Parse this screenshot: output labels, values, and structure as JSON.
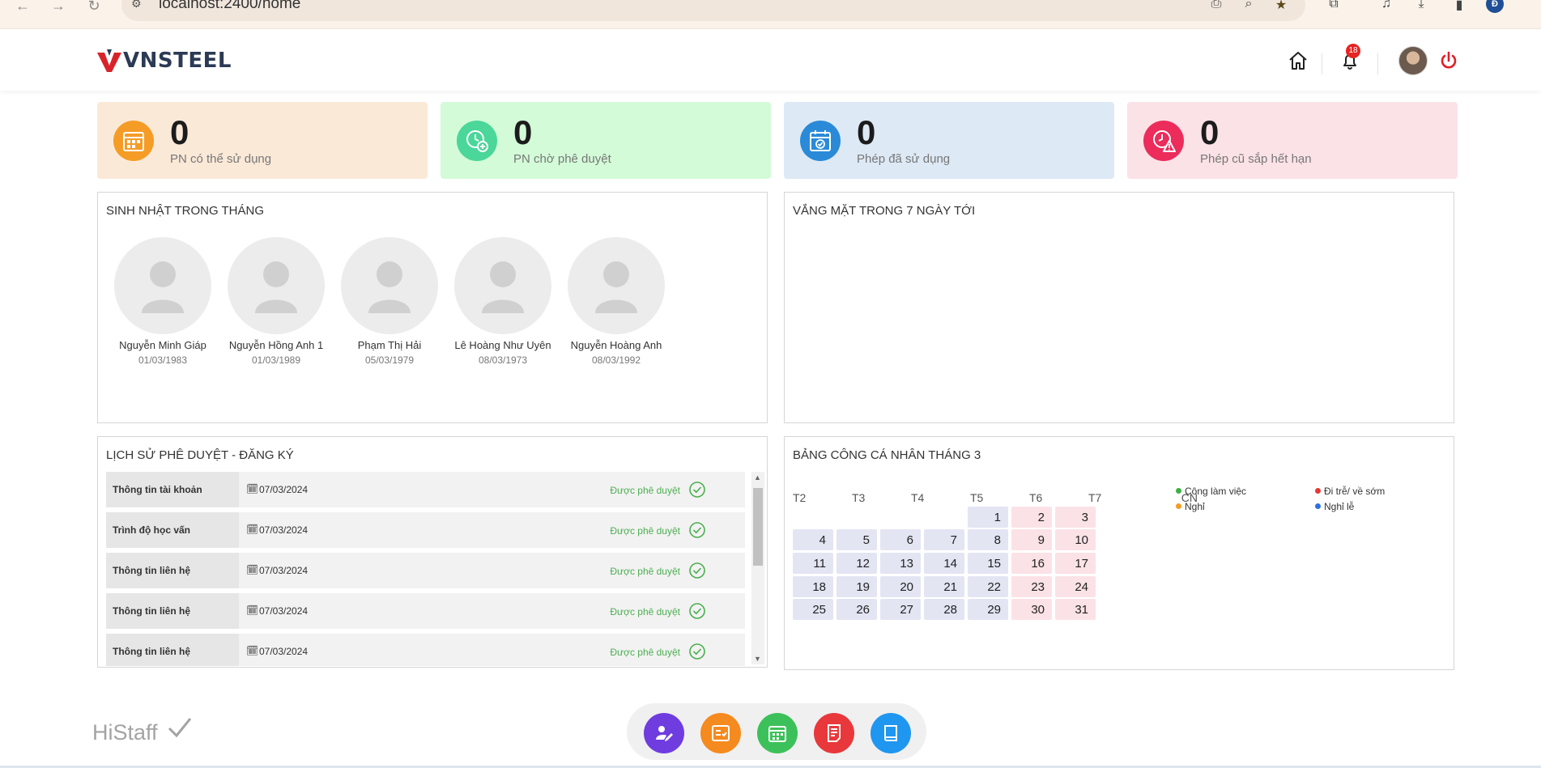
{
  "browser": {
    "url": "localhost:2400/home",
    "profile_initial": "Đ"
  },
  "header": {
    "logo_text": "VNSTEEL",
    "notification_count": "18"
  },
  "stats": [
    {
      "value": "0",
      "label": "PN có thể sử dụng",
      "bg": "#fbe9d8",
      "icon_bg": "#f59c26",
      "icon": "calendar-grid-icon"
    },
    {
      "value": "0",
      "label": "PN chờ phê duyệt",
      "bg": "#d3fbd8",
      "icon_bg": "#4bd69a",
      "icon": "clock-plus-icon"
    },
    {
      "value": "0",
      "label": "Phép đã sử dụng",
      "bg": "#dde9f5",
      "icon_bg": "#2a8ad8",
      "icon": "calendar-check-icon"
    },
    {
      "value": "0",
      "label": "Phép cũ sắp hết hạn",
      "bg": "#fbe2e7",
      "icon_bg": "#ec2c5b",
      "icon": "clock-warning-icon"
    }
  ],
  "birthdays": {
    "title": "SINH NHẬT TRONG THÁNG",
    "people": [
      {
        "name": "Nguyễn Minh Giáp",
        "date": "01/03/1983"
      },
      {
        "name": "Nguyễn Hồng Anh 1",
        "date": "01/03/1989"
      },
      {
        "name": "Phạm Thị Hải",
        "date": "05/03/1979"
      },
      {
        "name": "Lê Hoàng Như Uyên",
        "date": "08/03/1973"
      },
      {
        "name": "Nguyễn Hoàng Anh",
        "date": "08/03/1992"
      }
    ]
  },
  "absence": {
    "title": "VẮNG MẶT TRONG 7 NGÀY TỚI"
  },
  "history": {
    "title": "LỊCH SỬ PHÊ DUYỆT - ĐĂNG KÝ",
    "rows": [
      {
        "type": "Thông tin tài khoản",
        "date": "07/03/2024",
        "status": "Được phê duyệt"
      },
      {
        "type": "Trình độ học vấn",
        "date": "07/03/2024",
        "status": "Được phê duyệt"
      },
      {
        "type": "Thông tin liên hệ",
        "date": "07/03/2024",
        "status": "Được phê duyệt"
      },
      {
        "type": "Thông tin liên hệ",
        "date": "07/03/2024",
        "status": "Được phê duyệt"
      },
      {
        "type": "Thông tin liên hệ",
        "date": "07/03/2024",
        "status": "Được phê duyệt"
      }
    ]
  },
  "timesheet": {
    "title": "BẢNG CÔNG CÁ NHÂN THÁNG 3",
    "weekdays": [
      "T2",
      "T3",
      "T4",
      "T5",
      "T6",
      "T7",
      "CN"
    ],
    "weeks": [
      [
        "",
        "",
        "",
        "",
        "1",
        "2",
        "3"
      ],
      [
        "4",
        "5",
        "6",
        "7",
        "8",
        "9",
        "10"
      ],
      [
        "11",
        "12",
        "13",
        "14",
        "15",
        "16",
        "17"
      ],
      [
        "18",
        "19",
        "20",
        "21",
        "22",
        "23",
        "24"
      ],
      [
        "25",
        "26",
        "27",
        "28",
        "29",
        "30",
        "31"
      ]
    ],
    "legend": [
      {
        "label": "Công làm việc",
        "color": "#3cb043"
      },
      {
        "label": "Đi trễ/ về sớm",
        "color": "#e53935"
      },
      {
        "label": "Nghỉ",
        "color": "#f59c26"
      },
      {
        "label": "Nghỉ lễ",
        "color": "#2f6fe0"
      }
    ]
  },
  "dock": [
    {
      "name": "edit-profile",
      "color": "#6f3ce0"
    },
    {
      "name": "checklist",
      "color": "#f58a1f"
    },
    {
      "name": "calendar",
      "color": "#3cc15a"
    },
    {
      "name": "document",
      "color": "#e8383b"
    },
    {
      "name": "book",
      "color": "#1f96f0"
    }
  ],
  "footer": {
    "brand": "HiStaff"
  }
}
